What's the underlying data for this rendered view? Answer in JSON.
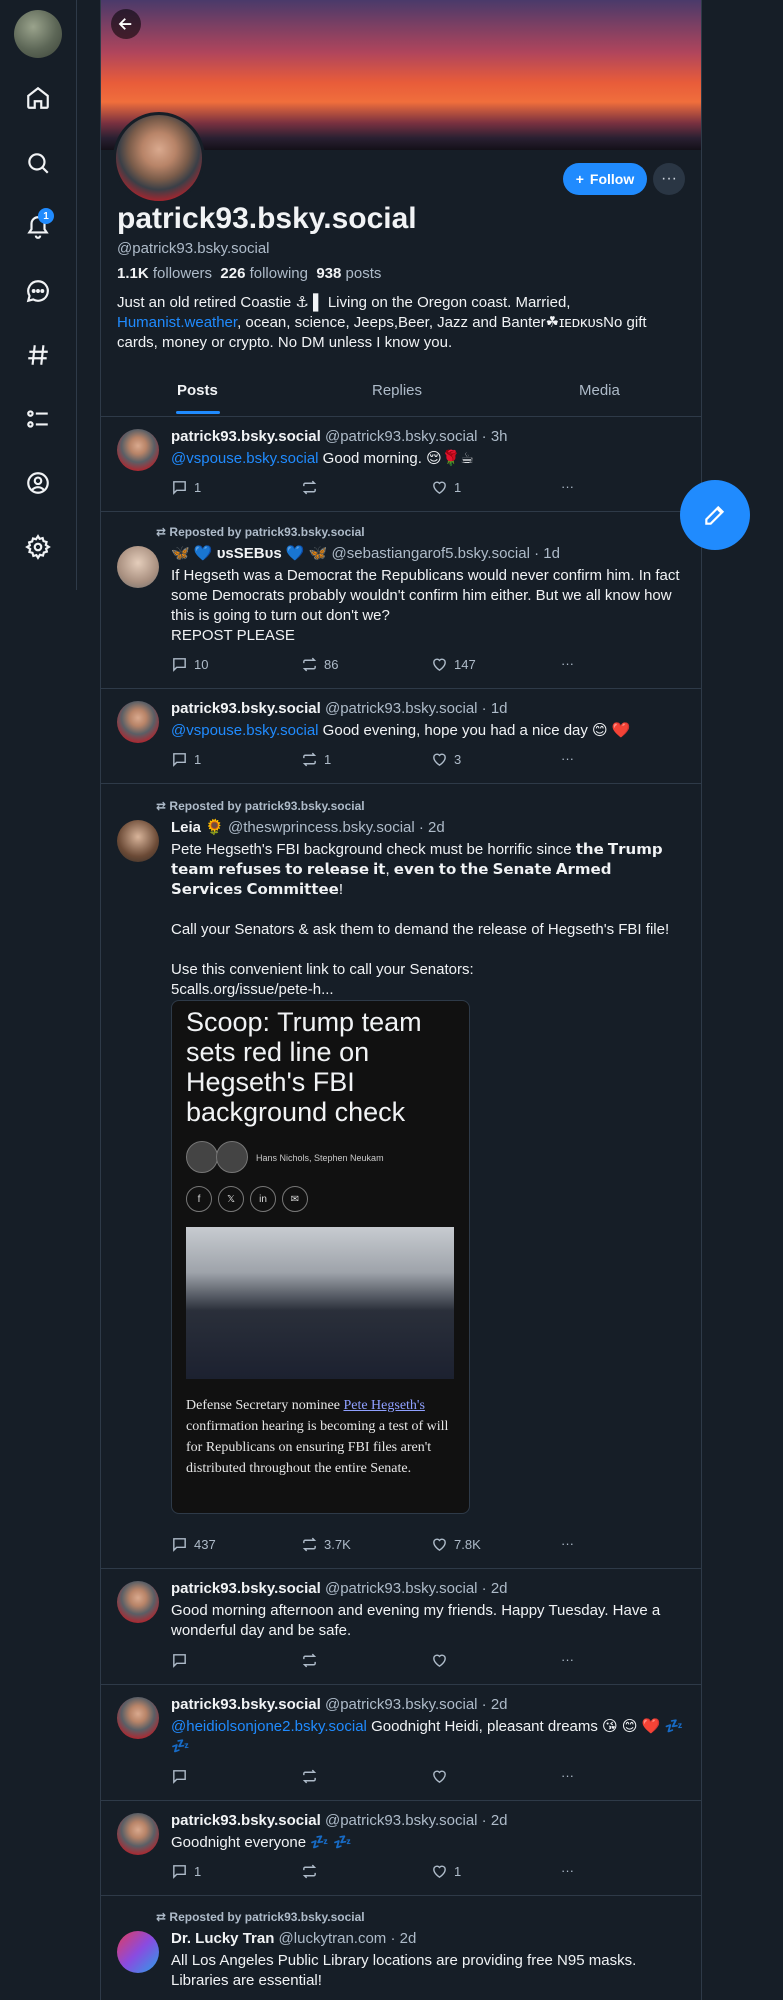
{
  "sidebar": {
    "notification_count": "1"
  },
  "profile": {
    "display_name": "patrick93.bsky.social",
    "handle": "@patrick93.bsky.social",
    "followers_count": "1.1K",
    "followers_label": "followers",
    "following_count": "226",
    "following_label": "following",
    "posts_count": "938",
    "posts_label": "posts",
    "bio_part1": "Just an old retired Coastie ⚓ ▌ Living on the Oregon coast. Married,",
    "bio_link": "Humanist.weather",
    "bio_part2": ", ocean, science, Jeeps,Beer, Jazz and Banter☘ɪᴇᴅᴋᴜsNo gift cards, money or crypto. No DM unless I know you.",
    "follow_label": "Follow"
  },
  "tabs": [
    "Posts",
    "Replies",
    "Media"
  ],
  "posts": [
    {
      "name": "patrick93.bsky.social",
      "handle": "@patrick93.bsky.social · 3h",
      "mention": "@vspouse.bsky.social",
      "text": " Good morning. 😌🌹☕",
      "replies": "1",
      "reposts": "",
      "likes": "1"
    },
    {
      "repost_label": "Reposted by patrick93.bsky.social",
      "name": "🦋 💙 ᴜsSEBᴜs 💙 🦋",
      "handle": "@sebastiangarof5.bsky.social · 1d",
      "text": "If Hegseth was a Democrat the Republicans would never confirm him. In fact some Democrats probably wouldn't confirm him either.  But we all know how this is going to turn out don't we?",
      "text2": "REPOST PLEASE",
      "replies": "10",
      "reposts": "86",
      "likes": "147"
    },
    {
      "name": "patrick93.bsky.social",
      "handle": "@patrick93.bsky.social · 1d",
      "mention": "@vspouse.bsky.social",
      "text": " Good evening, hope you had a nice day 😊 ❤️",
      "replies": "1",
      "reposts": "1",
      "likes": "3"
    },
    {
      "repost_label": "Reposted by patrick93.bsky.social",
      "name": "Leia 🌻",
      "handle": "@theswprincess.bsky.social · 2d",
      "text": "Pete Hegseth's FBI background check must be horrific since 𝘁𝗵𝗲 𝗧𝗿𝘂𝗺𝗽 𝘁𝗲𝗮𝗺 𝗿𝗲𝗳𝘂𝘀𝗲𝘀 𝘁𝗼 𝗿𝗲𝗹𝗲𝗮𝘀𝗲 𝗶𝘁, 𝗲𝘃𝗲𝗻 𝘁𝗼 𝘁𝗵𝗲 𝗦𝗲𝗻𝗮𝘁𝗲 𝗔𝗿𝗺𝗲𝗱 𝗦𝗲𝗿𝘃𝗶𝗰𝗲𝘀 𝗖𝗼𝗺𝗺𝗶𝘁𝘁𝗲𝗲!",
      "text2": "Call your Senators & ask them to demand the release of Hegseth's FBI file!",
      "text3": "Use this convenient link to call your Senators:",
      "link": "5calls.org/issue/pete-h...",
      "card_title": "Scoop: Trump team sets red line on Hegseth's FBI background check",
      "card_authors": "Hans Nichols, Stephen Neukam",
      "card_snippet_a": "Defense Secretary nominee ",
      "card_snippet_link": "Pete Hegseth's",
      "card_snippet_b": " confirmation hearing is becoming a test of will for Republicans on ensuring FBI files aren't distributed throughout the entire Senate.",
      "replies": "437",
      "reposts": "3.7K",
      "likes": "7.8K"
    },
    {
      "name": "patrick93.bsky.social",
      "handle": "@patrick93.bsky.social · 2d",
      "text": "Good morning afternoon and evening my friends. Happy Tuesday. Have a wonderful day and be safe.",
      "replies": "",
      "reposts": "",
      "likes": ""
    },
    {
      "name": "patrick93.bsky.social",
      "handle": "@patrick93.bsky.social · 2d",
      "mention": "@heidiolsonjone2.bsky.social",
      "text": " Goodnight Heidi, pleasant dreams 😘 😊 ❤️ 💤 💤",
      "replies": "",
      "reposts": "",
      "likes": ""
    },
    {
      "name": "patrick93.bsky.social",
      "handle": "@patrick93.bsky.social · 2d",
      "text": "Goodnight everyone 💤 💤",
      "replies": "1",
      "reposts": "",
      "likes": "1"
    },
    {
      "repost_label": "Reposted by patrick93.bsky.social",
      "name": "Dr. Lucky Tran",
      "handle": "@luckytran.com · 2d",
      "text": "All Los Angeles Public Library locations are providing free N95 masks. Libraries are essential!"
    }
  ],
  "colors": {
    "background": "#161e27",
    "accent": "#208bfe",
    "muted_text": "#aebbc9",
    "border": "#2e3a48"
  }
}
